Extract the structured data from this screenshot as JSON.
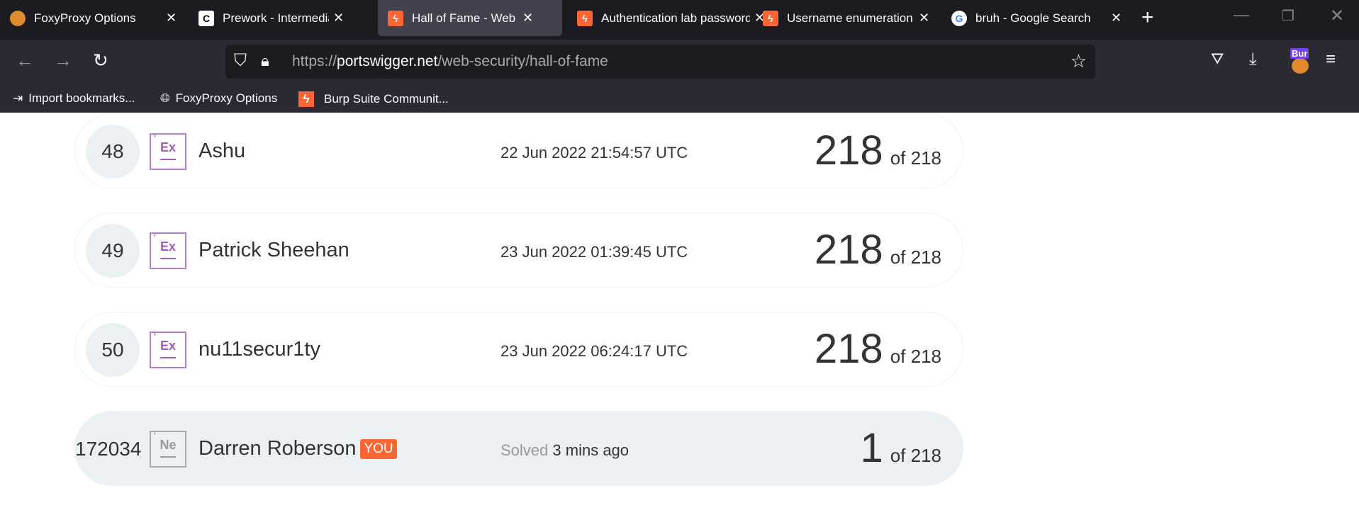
{
  "browser": {
    "tabs": [
      {
        "title": "FoxyProxy Options",
        "icon": "foxyproxy-icon",
        "active": false
      },
      {
        "title": "Prework - Intermediate",
        "icon": "codepath-icon",
        "active": false
      },
      {
        "title": "Hall of Fame - Web Security",
        "icon": "burp-icon",
        "active": true
      },
      {
        "title": "Authentication lab passwords",
        "icon": "burp-icon",
        "active": false
      },
      {
        "title": "Username enumeration",
        "icon": "burp-icon",
        "active": false
      },
      {
        "title": "bruh - Google Search",
        "icon": "google-icon",
        "active": false
      }
    ],
    "url_prefix": "https://",
    "url_domain": "portswigger.net",
    "url_path": "/web-security/hall-of-fame",
    "extension_badge": "Bur",
    "bookmarks": [
      "Import bookmarks...",
      "FoxyProxy Options",
      "Burp Suite Communit..."
    ]
  },
  "leaderboard": [
    {
      "rank": "48",
      "element": "Ex",
      "name": "Ashu",
      "date": "22 Jun 2022 21:54:57 UTC",
      "solved": "218",
      "of": "of 218"
    },
    {
      "rank": "49",
      "element": "Ex",
      "name": "Patrick Sheehan",
      "date": "23 Jun 2022 01:39:45 UTC",
      "solved": "218",
      "of": "of 218"
    },
    {
      "rank": "50",
      "element": "Ex",
      "name": "nu11secur1ty",
      "date": "23 Jun 2022 06:24:17 UTC",
      "solved": "218",
      "of": "of 218"
    }
  ],
  "me": {
    "rank": "172034",
    "element": "Ne",
    "name": "Darren Roberson",
    "badge": "YOU",
    "solved_label": "Solved",
    "when": "3 mins ago",
    "solved": "1",
    "of": "of 218"
  },
  "colors": {
    "accent": "#ff6633",
    "expert": "#a35ebe"
  }
}
